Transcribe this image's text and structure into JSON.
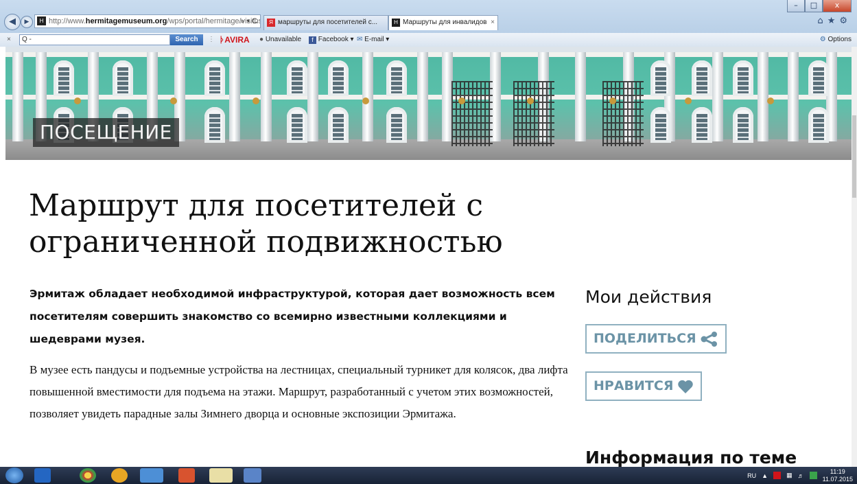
{
  "browser": {
    "address_prefix": "http://www.",
    "address_domain": "hermitagemuseum.org",
    "address_path": "/wps/portal/hermitage/visitus/re",
    "address_controls": "⌕ ▾ C",
    "tabs": [
      {
        "label": "маршруты для посетителей с...",
        "favicon_color": "#d8282c"
      },
      {
        "label": "Маршруты для инвалидов",
        "favicon_color": "#1d1d1d"
      }
    ],
    "tab_close": "×",
    "toolbar": {
      "search_value": "Q -",
      "search_button": "Search",
      "avira": "AVIRA",
      "unavailable": "Unavailable",
      "facebook": "Facebook ▾",
      "email": "E-mail ▾",
      "options": "Options"
    },
    "window_controls": {
      "minimize": "–",
      "maximize": "□",
      "close": "x"
    }
  },
  "hero": {
    "label": "ПОСЕЩЕНИЕ"
  },
  "main": {
    "title": "Маршрут для посетителей с ограниченной подвижностью",
    "lead": "Эрмитаж обладает необходимой инфраструктурой, которая дает возможность всем посетителям совершить знакомство со всемирно известными коллекциями и шедеврами музея.",
    "body": "В музее есть пандусы и подъемные устройства на лестницах, специальный турникет для колясок, два лифта повышенной вместимости для подъема на этажи. Маршрут, разработанный с учетом этих возможностей, позволяет увидеть парадные залы Зимнего дворца и основные экспозиции Эрмитажа."
  },
  "sidebar": {
    "actions_heading": "Мои действия",
    "share_button": "ПОДЕЛИТЬСЯ",
    "like_button": "НРАВИТСЯ",
    "info_heading": "Информация по теме",
    "accent_color": "#6b93a6"
  },
  "taskbar": {
    "language": "RU",
    "time": "11:19",
    "date": "11.07.2015"
  }
}
